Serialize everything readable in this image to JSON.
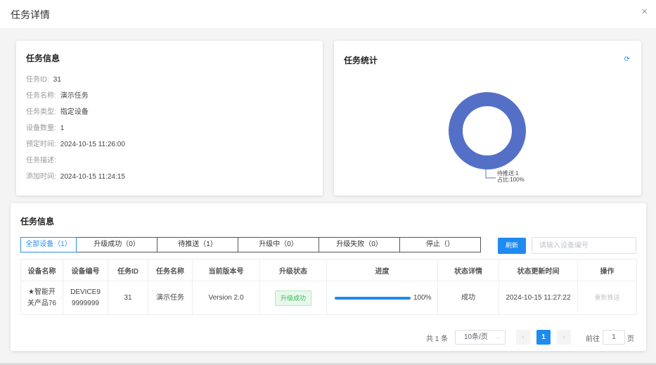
{
  "dialog": {
    "title": "任务详情",
    "close_glyph": "×"
  },
  "info_card": {
    "title": "任务信息",
    "rows": [
      {
        "label": "任务ID:",
        "value": "31"
      },
      {
        "label": "任务名称:",
        "value": "演示任务"
      },
      {
        "label": "任务类型:",
        "value": "指定设备"
      },
      {
        "label": "设备数量:",
        "value": "1"
      },
      {
        "label": "预定时间:",
        "value": "2024-10-15 11:26:00"
      },
      {
        "label": "任务描述:",
        "value": ""
      },
      {
        "label": "添加时间:",
        "value": "2024-10-15 11:24:15"
      }
    ]
  },
  "stats_card": {
    "title": "任务统计",
    "refresh_glyph": "⟳",
    "legend_line1": "待推送:1",
    "legend_line2": "占比:100%",
    "slice_color": "#5470c6",
    "chart_data": {
      "type": "pie",
      "categories": [
        "待推送"
      ],
      "values": [
        1
      ],
      "percent": [
        100
      ]
    }
  },
  "table_card": {
    "title": "任务信息",
    "tabs": [
      {
        "label": "全部设备（1）",
        "active": true
      },
      {
        "label": "升级成功（0）",
        "active": false
      },
      {
        "label": "待推送（1）",
        "active": false
      },
      {
        "label": "升级中（0）",
        "active": false
      },
      {
        "label": "升级失败（0）",
        "active": false
      },
      {
        "label": "停止（）",
        "active": false
      }
    ],
    "refresh_button": "刷新",
    "search_placeholder": "请输入设备编号",
    "columns": [
      "设备名称",
      "设备编号",
      "任务ID",
      "任务名称",
      "当前版本号",
      "升级状态",
      "进度",
      "状态详情",
      "状态更新时间",
      "操作"
    ],
    "rows": [
      {
        "device_name_line1": "★智能开",
        "device_name_line2": "关产品76",
        "device_no_line1": "DEVICE9",
        "device_no_line2": "9999999",
        "task_id": "31",
        "task_name": "演示任务",
        "version": "Version 2.0",
        "upgrade_status": "升级成功",
        "progress": 100,
        "progress_text": "100%",
        "status_detail": "成功",
        "update_time": "2024-10-15 11:27:22",
        "action": "重新推送"
      }
    ]
  },
  "pagination": {
    "total": "共 1 条",
    "page_size": "10条/页",
    "current_page": "1",
    "goto_label": "前往",
    "goto_value": "1",
    "goto_suffix": "页"
  }
}
